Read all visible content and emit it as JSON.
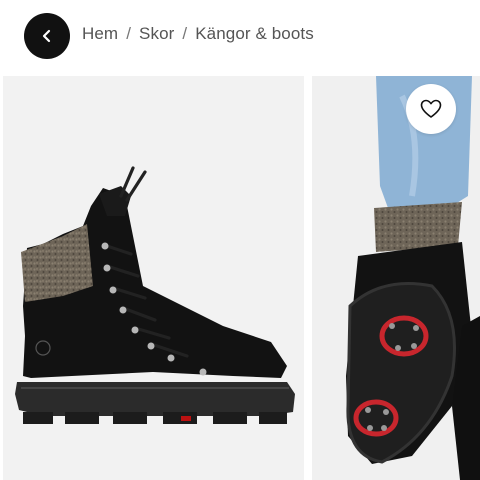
{
  "navigation": {
    "back_icon": "chevron-left-icon",
    "breadcrumb": [
      {
        "label": "Hem"
      },
      {
        "label": "Skor"
      },
      {
        "label": "Kängor & boots"
      }
    ],
    "separator": "/"
  },
  "gallery": {
    "favorite_icon": "heart-icon",
    "images": [
      {
        "subject": "boot-side-view"
      },
      {
        "subject": "boot-sole-view"
      }
    ]
  },
  "colors": {
    "back_button_bg": "#111111",
    "image_bg": "#f2f2f2",
    "breadcrumb_text": "#555555"
  }
}
